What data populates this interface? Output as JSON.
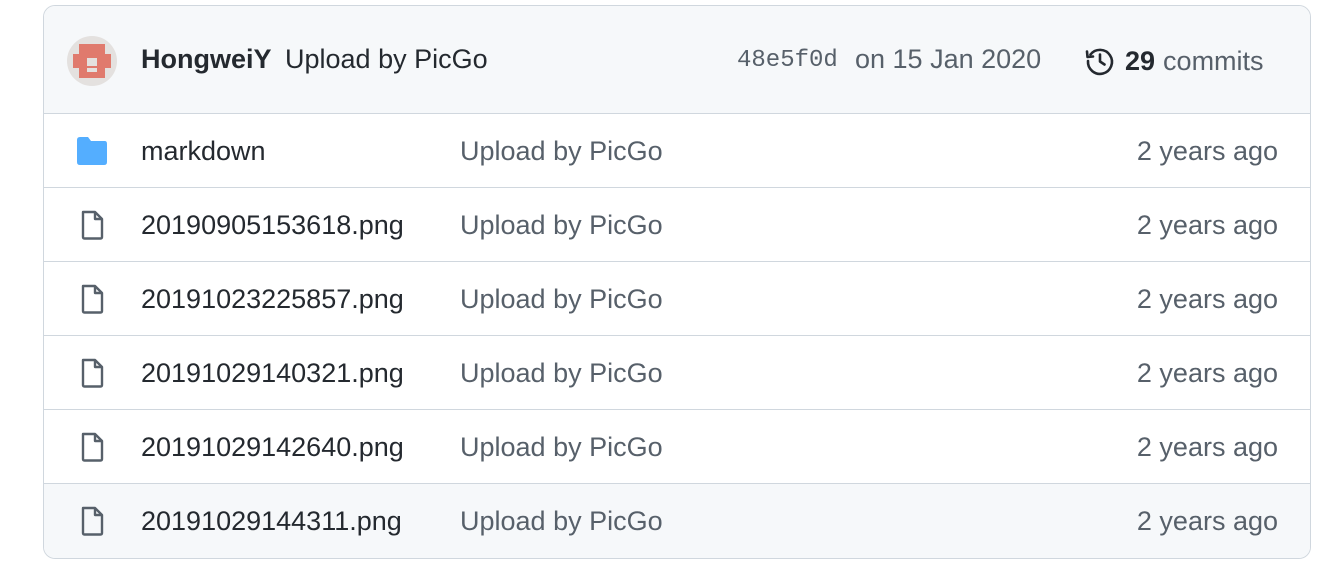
{
  "commit_header": {
    "author": "HongweiY",
    "message": "Upload by PicGo",
    "sha": "48e5f0d",
    "date": "on 15 Jan 2020",
    "commit_count": "29",
    "commit_label": "commits",
    "history_icon": "history-icon",
    "avatar_color": "#e07a6d"
  },
  "files": [
    {
      "type": "folder",
      "icon": "folder-icon",
      "name": "markdown",
      "message": "Upload by PicGo",
      "age": "2 years ago"
    },
    {
      "type": "file",
      "icon": "file-icon",
      "name": "20190905153618.png",
      "message": "Upload by PicGo",
      "age": "2 years ago"
    },
    {
      "type": "file",
      "icon": "file-icon",
      "name": "20191023225857.png",
      "message": "Upload by PicGo",
      "age": "2 years ago"
    },
    {
      "type": "file",
      "icon": "file-icon",
      "name": "20191029140321.png",
      "message": "Upload by PicGo",
      "age": "2 years ago"
    },
    {
      "type": "file",
      "icon": "file-icon",
      "name": "20191029142640.png",
      "message": "Upload by PicGo",
      "age": "2 years ago"
    },
    {
      "type": "file",
      "icon": "file-icon",
      "name": "20191029144311.png",
      "message": "Upload by PicGo",
      "age": "2 years ago"
    }
  ],
  "colors": {
    "folder": "#54aeff",
    "file_icon": "#57606a",
    "border": "#d0d7de",
    "header_bg": "#f6f8fa"
  }
}
